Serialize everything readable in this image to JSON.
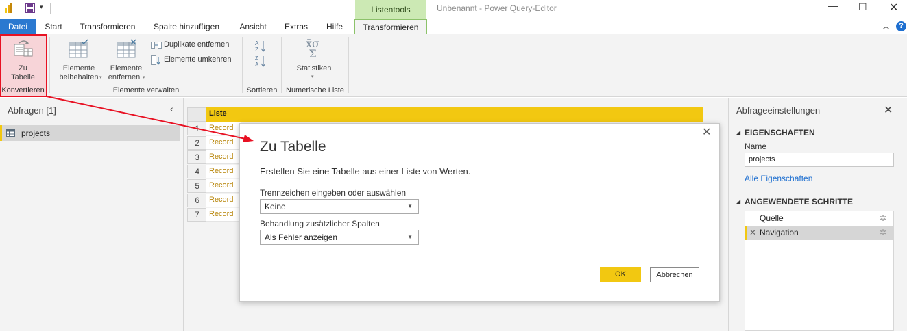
{
  "window": {
    "title": "Unbenannt - Power Query-Editor",
    "context_tab_group": "Listentools"
  },
  "tabs": [
    "Datei",
    "Start",
    "Transformieren",
    "Spalte hinzufügen",
    "Ansicht",
    "Extras",
    "Hilfe",
    "Transformieren"
  ],
  "ribbon": {
    "zu_tabelle": [
      "Zu",
      "Tabelle"
    ],
    "group_konvertieren": "Konvertieren",
    "elemente_beibehalten": [
      "Elemente",
      "beibehalten"
    ],
    "elemente_entfernen": [
      "Elemente",
      "entfernen"
    ],
    "duplikate_entfernen": "Duplikate entfernen",
    "elemente_umkehren": "Elemente umkehren",
    "group_elemente_verwalten": "Elemente verwalten",
    "group_sortieren": "Sortieren",
    "statistiken": "Statistiken",
    "group_numerische_liste": "Numerische Liste"
  },
  "queries": {
    "header": "Abfragen [1]",
    "items": [
      "projects"
    ]
  },
  "grid": {
    "column": "Liste",
    "rows": [
      {
        "n": "1",
        "v": "Record"
      },
      {
        "n": "2",
        "v": "Record"
      },
      {
        "n": "3",
        "v": "Record"
      },
      {
        "n": "4",
        "v": "Record"
      },
      {
        "n": "5",
        "v": "Record"
      },
      {
        "n": "6",
        "v": "Record"
      },
      {
        "n": "7",
        "v": "Record"
      }
    ]
  },
  "dialog": {
    "title": "Zu Tabelle",
    "description": "Erstellen Sie eine Tabelle aus einer Liste von Werten.",
    "delimiter_label": "Trennzeichen eingeben oder auswählen",
    "delimiter_value": "Keine",
    "extra_columns_label": "Behandlung zusätzlicher Spalten",
    "extra_columns_value": "Als Fehler anzeigen",
    "ok": "OK",
    "cancel": "Abbrechen"
  },
  "settings": {
    "header": "Abfrageeinstellungen",
    "properties_header": "EIGENSCHAFTEN",
    "name_label": "Name",
    "name_value": "projects",
    "all_properties": "Alle Eigenschaften",
    "steps_header": "ANGEWENDETE SCHRITTE",
    "steps": [
      "Quelle",
      "Navigation"
    ]
  },
  "colors": {
    "accent_yellow": "#f2c811",
    "file_tab": "#2b79d0",
    "context_tab": "#cce9b4",
    "annotation_red": "#e81123"
  }
}
